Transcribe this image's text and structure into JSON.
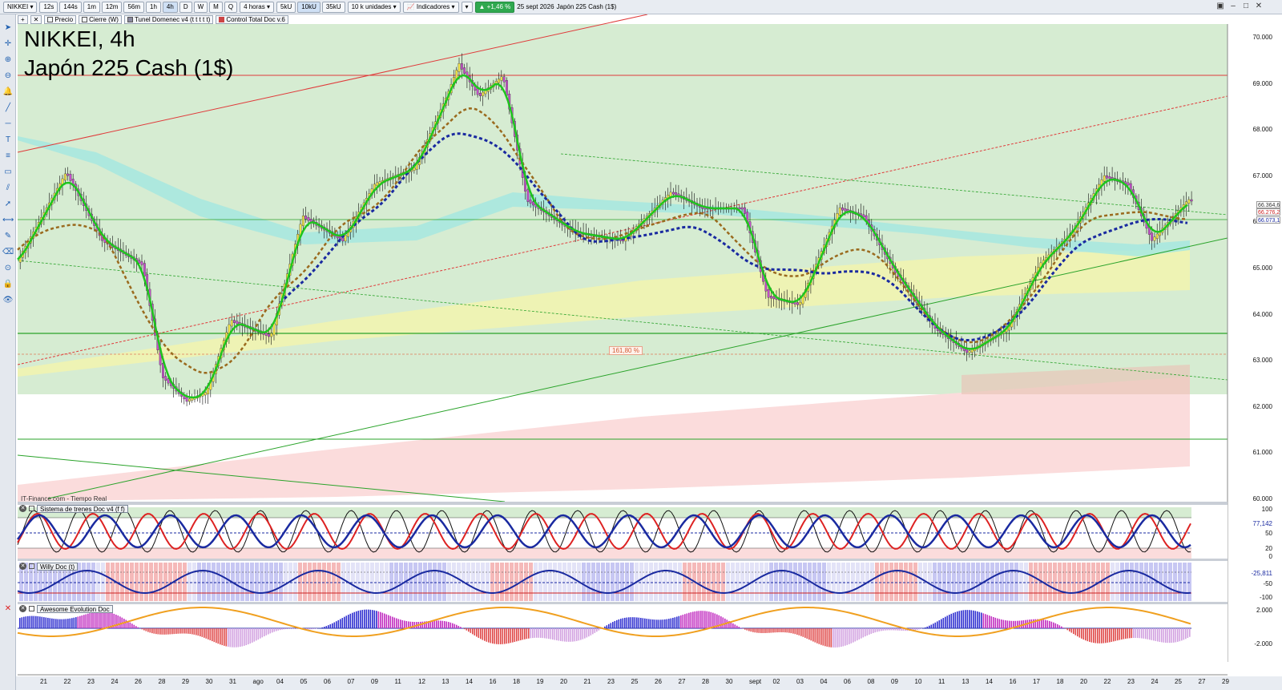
{
  "toolbar": {
    "symbol": "NIKKEI",
    "timeframes": [
      "12s",
      "144s",
      "1m",
      "12m",
      "56m",
      "1h",
      "4h",
      "D",
      "W",
      "M",
      "Q"
    ],
    "active_timeframe": "4h",
    "period_select": "4 horas",
    "volume_buttons": [
      "5kU",
      "10kU",
      "35kU"
    ],
    "active_volume": "10kU",
    "units_select": "10 k unidades",
    "indicators_label": "Indicadores",
    "change_badge": "+1,46 %",
    "date": "25 sept 2026",
    "instrument_name": "Japón 225 Cash (1$)"
  },
  "legend": {
    "items": [
      "Precio",
      "Cierre (W)",
      "Tunel Domenec v4 (t t t t t)",
      "Control Total Doc v.6"
    ]
  },
  "chart": {
    "title_line1": "NIKKEI, 4h",
    "title_line2": "Japón 225 Cash (1$)",
    "source": "IT-Finance.com - Tiempo Real",
    "fibo_label": "161,80 %",
    "y_axis_labels": [
      "70.000",
      "69.000",
      "68.000",
      "67.000",
      "66.000",
      "65.000",
      "64.000",
      "63.000",
      "62.000",
      "61.000",
      "60.000"
    ],
    "price_boxes": [
      "66.364,6",
      "66.276,2",
      "66.073,1"
    ],
    "colors": {
      "bull_candle": "#f1e24a",
      "bear_candle": "#c44fc9",
      "fast_up": "#1ec51e",
      "fast_down": "#e0221e",
      "blue_dotted": "#1a2aa0",
      "brown_dotted": "#9a6a1e",
      "bg_green": "#d6ecd2",
      "bg_yellow": "#eef3b4",
      "bg_red": "#fbdcdc",
      "band_cyan": "#9fe6e0"
    }
  },
  "panes": [
    {
      "name": "Sistema de trenes Doc v4 (f f)",
      "labels": [
        "100",
        "77,142",
        "50",
        "20",
        "0"
      ]
    },
    {
      "name": "Willy Doc (t)",
      "labels": [
        "-25,811",
        "-50",
        "-100"
      ]
    },
    {
      "name": "Awesome Evolution Doc",
      "labels": [
        "2.000",
        "-2.000"
      ]
    }
  ],
  "x_axis": {
    "labels": [
      "21",
      "22",
      "23",
      "24",
      "26",
      "28",
      "29",
      "30",
      "31",
      "ago",
      "04",
      "05",
      "06",
      "07",
      "09",
      "11",
      "12",
      "13",
      "14",
      "16",
      "18",
      "19",
      "20",
      "21",
      "23",
      "25",
      "26",
      "27",
      "28",
      "30",
      "sept",
      "02",
      "03",
      "04",
      "06",
      "08",
      "09",
      "10",
      "11",
      "13",
      "14",
      "16",
      "17",
      "18",
      "20",
      "22",
      "23",
      "24",
      "25",
      "27",
      "29"
    ]
  },
  "left_tools": [
    "cursor-icon",
    "crosshair-icon",
    "zoom-in-icon",
    "zoom-out-icon",
    "alert-icon",
    "trend-line-icon",
    "horizontal-line-icon",
    "text-icon",
    "fibonacci-icon",
    "rectangle-icon",
    "channel-icon",
    "arrow-icon",
    "measure-icon",
    "pencil-icon",
    "eraser-icon",
    "magnet-icon",
    "lock-icon",
    "eye-icon",
    "delete-icon"
  ]
}
